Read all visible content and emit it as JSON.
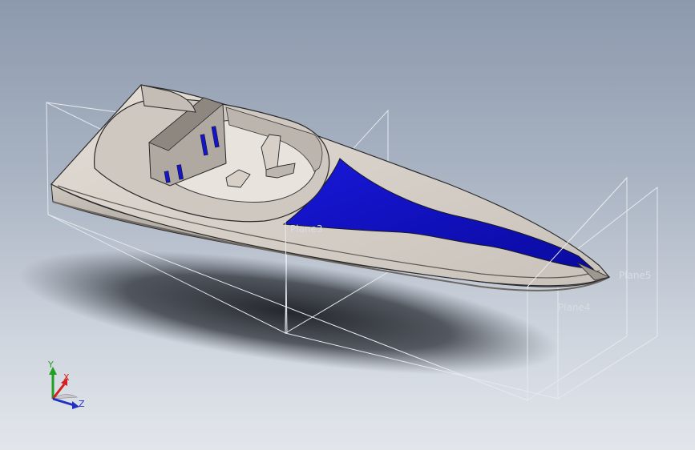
{
  "viewport": {
    "background_top": "#8c99ad",
    "background_bottom": "#e2e6eb"
  },
  "model": {
    "hull_color": "#d8d2cb",
    "hull_shadow_color": "#a59f98",
    "deck_stripe_color": "#1010cc",
    "edge_color": "#2a2a2a"
  },
  "reference_planes": {
    "labels": [
      "Plane3",
      "Plane4",
      "Plane5"
    ],
    "line_color": "#e6e9ee"
  },
  "triad": {
    "x_label": "X",
    "y_label": "Y",
    "z_label": "Z",
    "x_color": "#d42020",
    "y_color": "#20a020",
    "z_color": "#2030c0"
  }
}
